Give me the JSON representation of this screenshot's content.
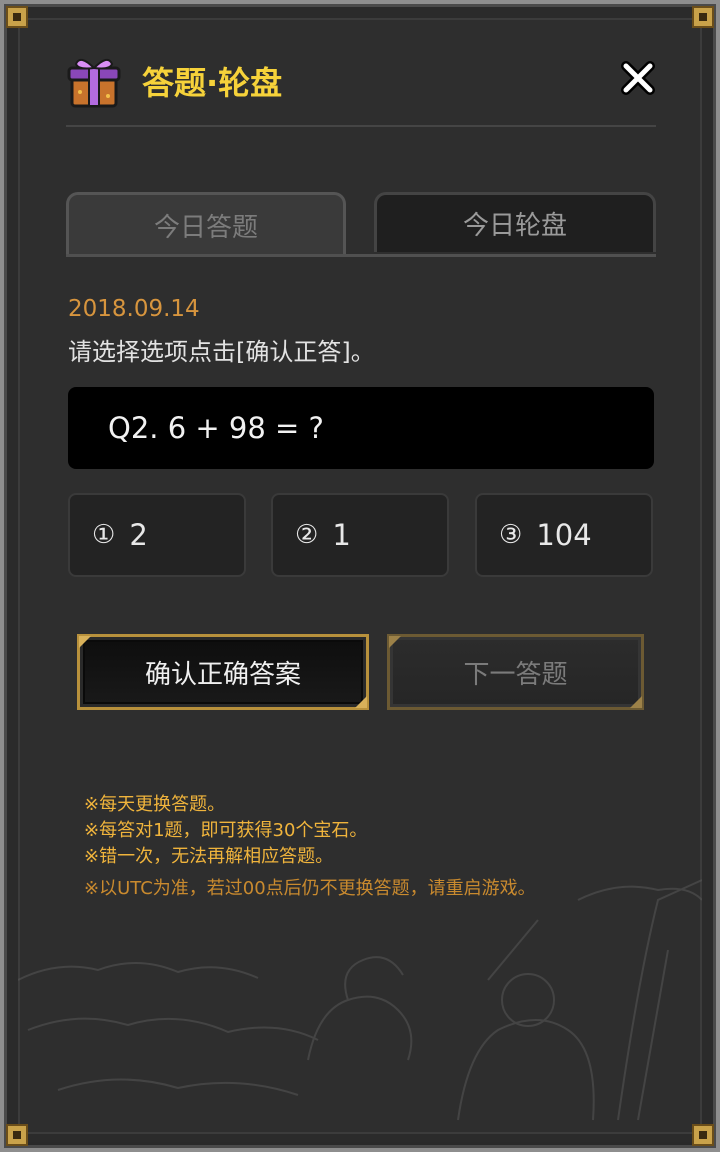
{
  "window": {
    "title": "答题·轮盘"
  },
  "header": {
    "icon": "gift-box-icon",
    "close_icon": "close-icon"
  },
  "tabs": [
    {
      "label": "今日答题",
      "active": true
    },
    {
      "label": "今日轮盘",
      "active": false
    }
  ],
  "quiz": {
    "date": "2018.09.14",
    "instruction": "请选择选项点击[确认正答]。",
    "question": "Q2. 6 + 98 = ?",
    "options": [
      {
        "marker": "①",
        "value": "2"
      },
      {
        "marker": "②",
        "value": "1"
      },
      {
        "marker": "③",
        "value": "104"
      }
    ]
  },
  "buttons": {
    "confirm": "确认正确答案",
    "next": "下一答题"
  },
  "notes": [
    "※每天更换答题。",
    "※每答对1题，即可获得30个宝石。",
    "※错一次，无法再解相应答题。",
    "※以UTC为准，若过00点后仍不更换答题，请重启游戏。"
  ],
  "colors": {
    "title": "#f6d23a",
    "date": "#d7953e",
    "notes": "#f0b43c",
    "frame_gold": "#c9a24a"
  }
}
